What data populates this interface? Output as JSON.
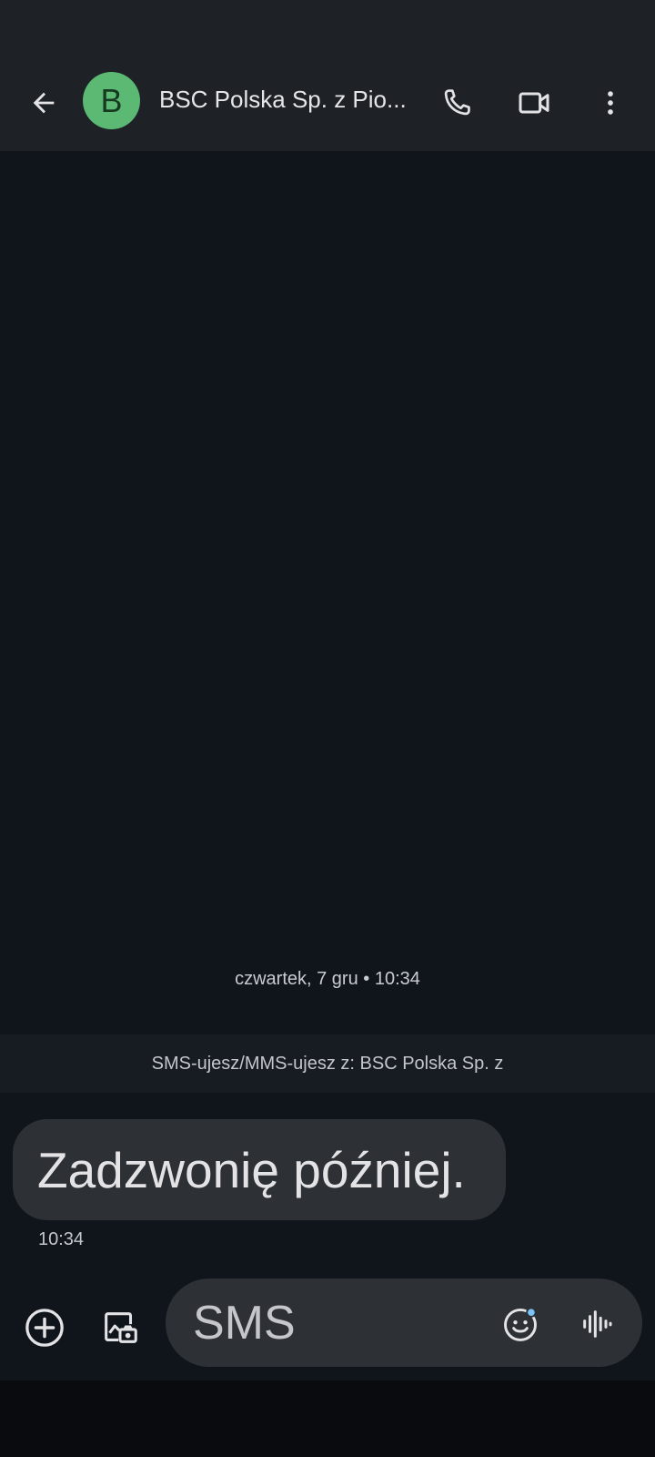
{
  "header": {
    "avatar_letter": "B",
    "avatar_color": "#5bb974",
    "contact_name": "BSC Polska Sp. z Pio...",
    "back_icon": "arrow-back-icon",
    "call_icon": "phone-icon",
    "video_icon": "videocam-icon",
    "more_icon": "more-vert-icon"
  },
  "conversation": {
    "date_separator": "czwartek, 7 gru • 10:34",
    "sms_banner": "SMS-ujesz/MMS-ujesz z: BSC Polska Sp. z",
    "messages": [
      {
        "text": "Zadzwonię później.",
        "time": "10:34"
      }
    ]
  },
  "compose": {
    "placeholder": "SMS",
    "add_icon": "add-circle-icon",
    "gallery_icon": "gallery-camera-icon",
    "emoji_icon": "emoji-icon",
    "voice_icon": "voice-waveform-icon"
  },
  "colors": {
    "background": "#10151c",
    "app_bar": "#1e2226",
    "bubble": "#2d3135",
    "emoji_badge": "#7cc4f8"
  }
}
